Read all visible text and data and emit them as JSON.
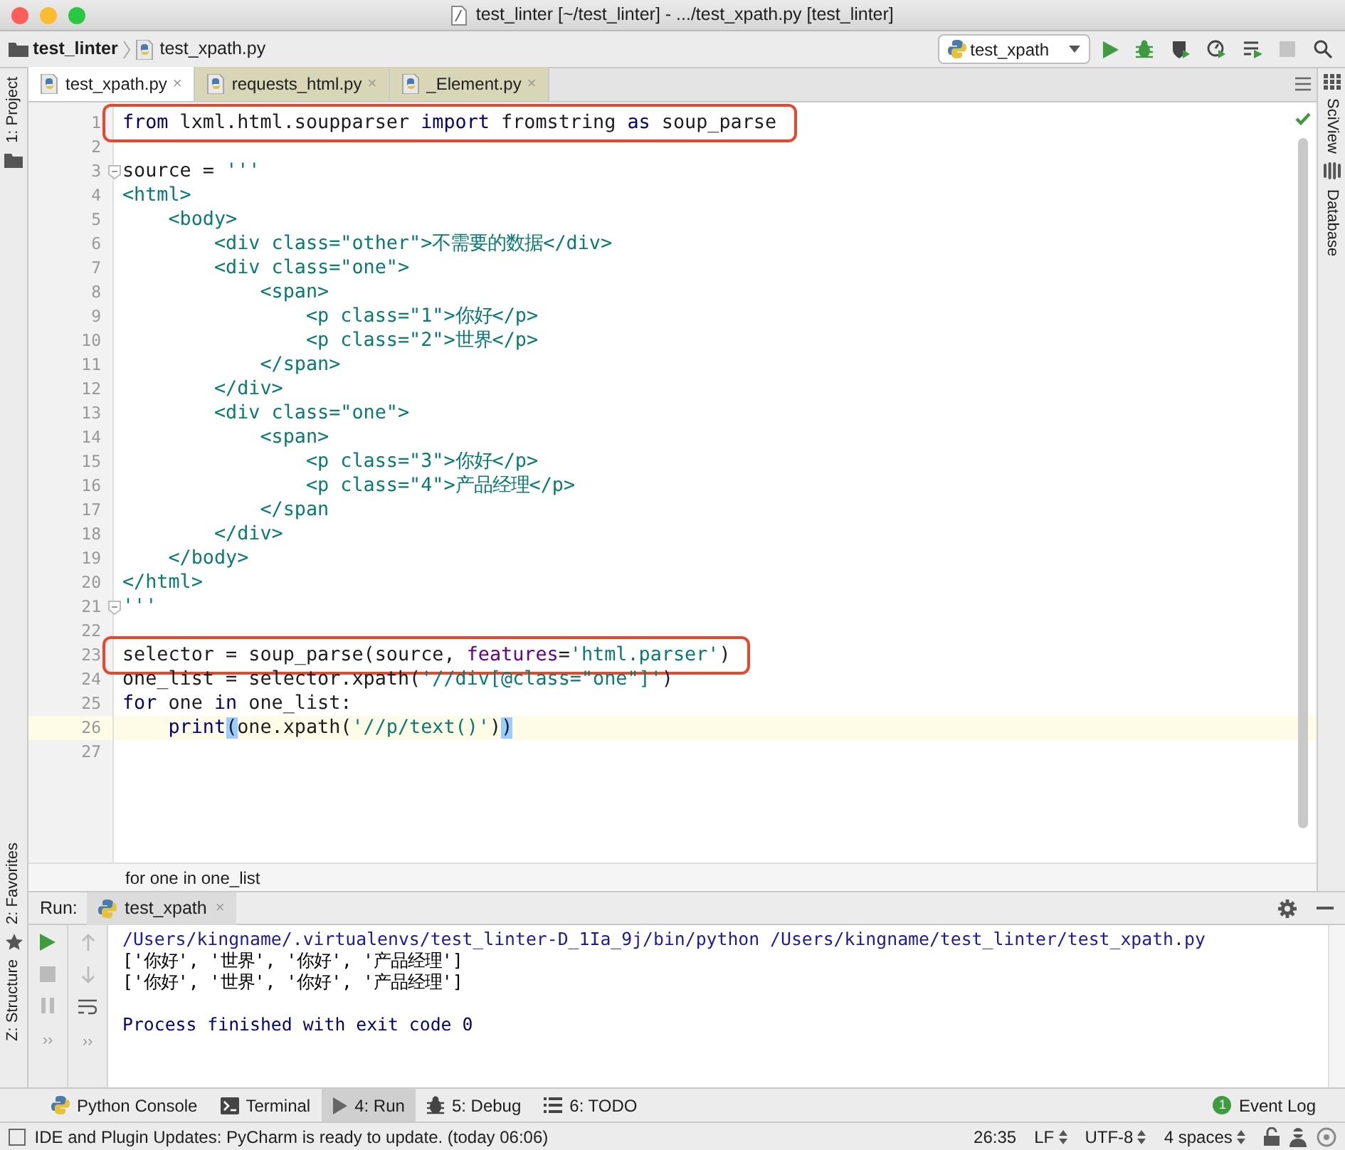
{
  "window": {
    "title": "test_linter [~/test_linter] - .../test_xpath.py [test_linter]"
  },
  "navigation_bar": {
    "breadcrumbs": [
      {
        "label": "test_linter"
      },
      {
        "label": "test_xpath.py"
      }
    ],
    "run_config": "test_xpath"
  },
  "editor_tabs": [
    {
      "label": "test_xpath.py",
      "close": "×",
      "selected": true
    },
    {
      "label": "requests_html.py",
      "close": "×",
      "selected": false
    },
    {
      "label": "_Element.py",
      "close": "×",
      "selected": false
    }
  ],
  "left_tool_strip": [
    {
      "label": "1: Project"
    },
    {
      "label": "2: Favorites"
    },
    {
      "label": "Z: Structure"
    }
  ],
  "right_tool_strip": [
    {
      "label": "SciView"
    },
    {
      "label": "Database"
    }
  ],
  "editor": {
    "lines": [
      {
        "number": "1",
        "boxed": true,
        "current": false,
        "tokens": [
          {
            "kind": "keyword",
            "text": "from"
          },
          {
            "kind": "plain",
            "text": " lxml.html.soupparser "
          },
          {
            "kind": "keyword",
            "text": "import"
          },
          {
            "kind": "plain",
            "text": " fromstring "
          },
          {
            "kind": "keyword",
            "text": "as"
          },
          {
            "kind": "plain",
            "text": " soup_parse"
          }
        ]
      },
      {
        "number": "2",
        "boxed": false,
        "current": false
      },
      {
        "number": "3",
        "boxed": false,
        "current": false,
        "fold": true,
        "tokens": [
          {
            "kind": "plain",
            "text": "source = "
          },
          {
            "kind": "string",
            "text": "'''"
          }
        ]
      },
      {
        "number": "4",
        "boxed": false,
        "current": false,
        "tokens": [
          {
            "kind": "string",
            "text": "<html>"
          }
        ]
      },
      {
        "number": "5",
        "boxed": false,
        "current": false,
        "tokens": [
          {
            "kind": "string",
            "text": "    <body>"
          }
        ]
      },
      {
        "number": "6",
        "boxed": false,
        "current": false,
        "tokens": [
          {
            "kind": "string",
            "text": "        <div class=\"other\">不需要的数据</div>"
          }
        ]
      },
      {
        "number": "7",
        "boxed": false,
        "current": false,
        "tokens": [
          {
            "kind": "string",
            "text": "        <div class=\"one\">"
          }
        ]
      },
      {
        "number": "8",
        "boxed": false,
        "current": false,
        "tokens": [
          {
            "kind": "string",
            "text": "            <span>"
          }
        ]
      },
      {
        "number": "9",
        "boxed": false,
        "current": false,
        "tokens": [
          {
            "kind": "string",
            "text": "                <p class=\"1\">你好</p>"
          }
        ]
      },
      {
        "number": "10",
        "boxed": false,
        "current": false,
        "tokens": [
          {
            "kind": "string",
            "text": "                <p class=\"2\">世界</p>"
          }
        ]
      },
      {
        "number": "11",
        "boxed": false,
        "current": false,
        "tokens": [
          {
            "kind": "string",
            "text": "            </span>"
          }
        ]
      },
      {
        "number": "12",
        "boxed": false,
        "current": false,
        "tokens": [
          {
            "kind": "string",
            "text": "        </div>"
          }
        ]
      },
      {
        "number": "13",
        "boxed": false,
        "current": false,
        "tokens": [
          {
            "kind": "string",
            "text": "        <div class=\"one\">"
          }
        ]
      },
      {
        "number": "14",
        "boxed": false,
        "current": false,
        "tokens": [
          {
            "kind": "string",
            "text": "            <span>"
          }
        ]
      },
      {
        "number": "15",
        "boxed": false,
        "current": false,
        "tokens": [
          {
            "kind": "string",
            "text": "                <p class=\"3\">你好</p>"
          }
        ]
      },
      {
        "number": "16",
        "boxed": false,
        "current": false,
        "tokens": [
          {
            "kind": "string",
            "text": "                <p class=\"4\">产品经理</p>"
          }
        ]
      },
      {
        "number": "17",
        "boxed": false,
        "current": false,
        "tokens": [
          {
            "kind": "string",
            "text": "            </span"
          }
        ]
      },
      {
        "number": "18",
        "boxed": false,
        "current": false,
        "tokens": [
          {
            "kind": "string",
            "text": "        </div>"
          }
        ]
      },
      {
        "number": "19",
        "boxed": false,
        "current": false,
        "tokens": [
          {
            "kind": "string",
            "text": "    </body>"
          }
        ]
      },
      {
        "number": "20",
        "boxed": false,
        "current": false,
        "tokens": [
          {
            "kind": "string",
            "text": "</html>"
          }
        ]
      },
      {
        "number": "21",
        "boxed": false,
        "current": false,
        "fold": true,
        "tokens": [
          {
            "kind": "string",
            "text": "'''"
          }
        ]
      },
      {
        "number": "22",
        "boxed": false,
        "current": false
      },
      {
        "number": "23",
        "boxed": true,
        "current": false,
        "tokens": [
          {
            "kind": "plain",
            "text": "selector = soup_parse(source, "
          },
          {
            "kind": "parameter",
            "text": "features"
          },
          {
            "kind": "plain",
            "text": "="
          },
          {
            "kind": "string",
            "text": "'html.parser'"
          },
          {
            "kind": "plain",
            "text": ")"
          }
        ]
      },
      {
        "number": "24",
        "boxed": false,
        "current": false,
        "tokens": [
          {
            "kind": "plain",
            "text": "one_list = selector.xpath("
          },
          {
            "kind": "string",
            "text": "'//div[@class=\"one\"]'"
          },
          {
            "kind": "plain",
            "text": ")"
          }
        ]
      },
      {
        "number": "25",
        "boxed": false,
        "current": false,
        "tokens": [
          {
            "kind": "keyword",
            "text": "for"
          },
          {
            "kind": "plain",
            "text": " one "
          },
          {
            "kind": "keyword",
            "text": "in"
          },
          {
            "kind": "plain",
            "text": " one_list:"
          }
        ]
      },
      {
        "number": "26",
        "boxed": false,
        "current": true,
        "tokens": [
          {
            "kind": "builtin",
            "text": "    print"
          },
          {
            "kind": "match",
            "text": "("
          },
          {
            "kind": "plain",
            "text": "one.xpath("
          },
          {
            "kind": "string",
            "text": "'//p/text()'"
          },
          {
            "kind": "plain",
            "text": ")"
          },
          {
            "kind": "match",
            "text": ")"
          }
        ]
      },
      {
        "number": "27",
        "boxed": false,
        "current": false
      }
    ],
    "breadcrumb": "for one in one_list"
  },
  "run_window": {
    "label": "Run:",
    "tab": "test_xpath",
    "tab_close": "×",
    "toolbar_overflow": [
      "››",
      "››"
    ],
    "output": [
      {
        "kind": "command",
        "text": "/Users/kingname/.virtualenvs/test_linter-D_1Ia_9j/bin/python /Users/kingname/test_linter/test_xpath.py"
      },
      {
        "kind": "stdout",
        "text": "['你好', '世界', '你好', '产品经理']"
      },
      {
        "kind": "stdout",
        "text": "['你好', '世界', '你好', '产品经理']"
      },
      {
        "kind": "blank"
      },
      {
        "kind": "system",
        "text": "Process finished with exit code 0"
      }
    ]
  },
  "tool_buttons": [
    {
      "label": "Python Console",
      "kind": "python",
      "selected": false
    },
    {
      "label": "Terminal",
      "kind": "terminal",
      "selected": false
    },
    {
      "label": "4: Run",
      "kind": "run",
      "selected": true
    },
    {
      "label": "5: Debug",
      "kind": "bug",
      "selected": false
    },
    {
      "label": "6: TODO",
      "kind": "list",
      "selected": false
    }
  ],
  "event_log": {
    "label": "Event Log",
    "count": "1"
  },
  "status_bar": {
    "message": "IDE and Plugin Updates: PyCharm is ready to update. (today 06:06)",
    "position": "26:35",
    "line_separator": "LF",
    "encoding": "UTF-8",
    "indent": "4 spaces"
  }
}
